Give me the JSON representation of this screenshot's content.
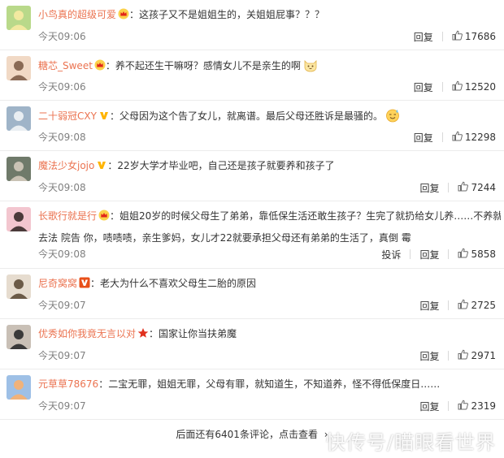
{
  "colors": {
    "username": "#eb7350",
    "text": "#333333",
    "time": "#808080",
    "divider": "#ececec",
    "crown": "#f5a623",
    "vip": "#ff8200",
    "star": "#e0301e"
  },
  "comments": [
    {
      "user": "小鸟真的超级可爱",
      "badge": "crown-icon",
      "sep": "：",
      "text": "这孩子又不是姐姐生的，关姐姐屁事？？？",
      "emoji": "",
      "line2": "",
      "time": "今天09:06",
      "reply": "回复",
      "report": "",
      "likes": "17686"
    },
    {
      "user": "糖芯_Sweet",
      "badge": "crown-icon",
      "sep": "：",
      "text": "养不起还生干嘛呀？感情女儿不是亲生的啊",
      "emoji": "cat-face-icon",
      "line2": "",
      "time": "今天09:06",
      "reply": "回复",
      "report": "",
      "likes": "12520"
    },
    {
      "user": "二十弱冠CXY",
      "badge": "vip-v-icon",
      "sep": "：",
      "text": "父母因为这个告了女儿，就离谱。最后父母还胜诉是最骚的。",
      "emoji": "sweat-smile-icon",
      "line2": "",
      "time": "今天09:08",
      "reply": "回复",
      "report": "",
      "likes": "12298"
    },
    {
      "user": "魔法少女jojo",
      "badge": "vip-v-icon",
      "sep": "：",
      "text": "22岁大学才毕业吧，自己还是孩子就要养和孩子了",
      "emoji": "",
      "line2": "",
      "time": "今天09:08",
      "reply": "回复",
      "report": "",
      "likes": "7244"
    },
    {
      "user": "长歌行就是行",
      "badge": "crown-icon",
      "sep": "：",
      "text": "姐姐20岁的时候父母生了弟弟，靠低保生活还敢生孩子？生完了就扔给女儿养……不养就",
      "emoji": "",
      "line2": "去法 院告 你，啧啧啧，亲生爹妈，女儿才22就要承担父母还有弟弟的生活了，真倒 霉",
      "time": "今天09:08",
      "reply": "回复",
      "report": "投诉",
      "likes": "5858"
    },
    {
      "user": "尼奇窝窝",
      "badge": "vip-box-icon",
      "sep": "：",
      "text": "老大为什么不喜欢父母生二胎的原因",
      "emoji": "",
      "line2": "",
      "time": "今天09:07",
      "reply": "回复",
      "report": "",
      "likes": "2725"
    },
    {
      "user": "优秀如你我竟无言以对",
      "badge": "star-icon",
      "sep": "：",
      "text": "国家让你当扶弟魔",
      "emoji": "",
      "line2": "",
      "time": "今天09:07",
      "reply": "回复",
      "report": "",
      "likes": "2971"
    },
    {
      "user": "元草草78676",
      "badge": "",
      "sep": "：",
      "text": "二宝无罪，姐姐无罪，父母有罪，就知道生，不知道养，怪不得低保度日……",
      "emoji": "",
      "line2": "",
      "time": "今天09:07",
      "reply": "回复",
      "report": "",
      "likes": "2319"
    }
  ],
  "more": {
    "text": "后面还有6401条评论，点击查看",
    "arrow": "›"
  },
  "watermark": "快传号/瞄眼看世界"
}
